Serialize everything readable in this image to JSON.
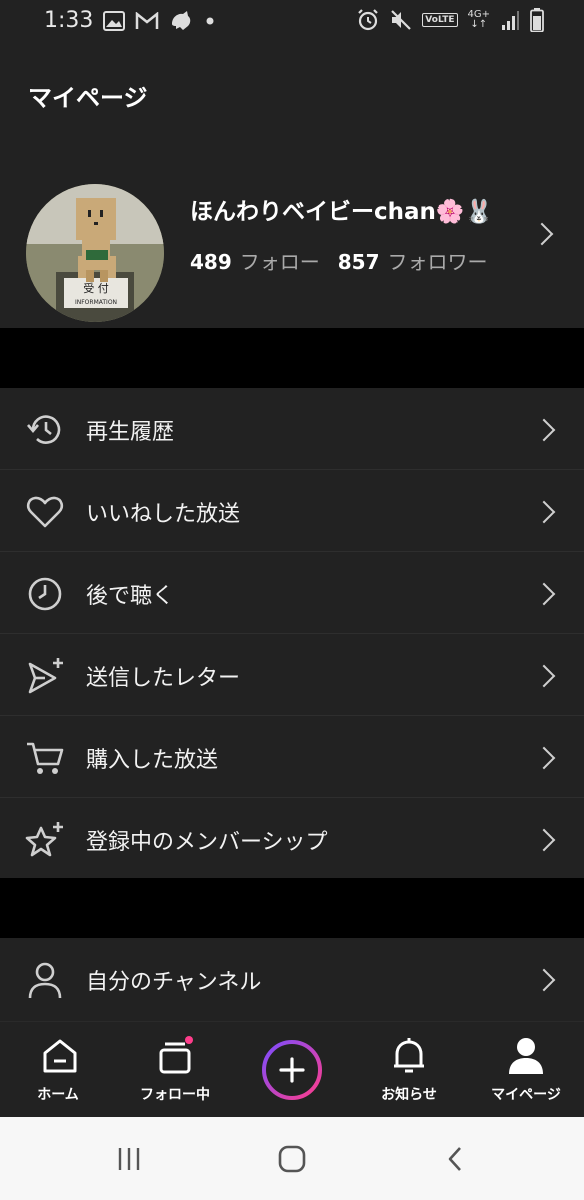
{
  "status_bar": {
    "time": "1:33",
    "left_icons": [
      "image-icon",
      "gmail-icon",
      "bird-icon",
      "dot-icon"
    ],
    "right_icons": [
      "alarm-icon",
      "mute-icon",
      "volte-icon",
      "4g-icon",
      "signal-icon",
      "battery-icon"
    ],
    "volte_label": "VoLTE",
    "network_label": "4G+"
  },
  "header": {
    "title": "マイページ",
    "profile": {
      "name": "ほんわりベイビーchan🌸🐰",
      "following_count": "489",
      "following_label": "フォロー",
      "followers_count": "857",
      "followers_label": "フォロワー",
      "avatar_sign_text": "受 付",
      "avatar_sign_subtext": "INFORMATION"
    }
  },
  "menu": {
    "items": [
      {
        "label": "再生履歴",
        "icon": "history-icon"
      },
      {
        "label": "いいねした放送",
        "icon": "heart-icon"
      },
      {
        "label": "後で聴く",
        "icon": "clock-icon"
      },
      {
        "label": "送信したレター",
        "icon": "send-plus-icon"
      },
      {
        "label": "購入した放送",
        "icon": "cart-icon"
      },
      {
        "label": "登録中のメンバーシップ",
        "icon": "star-plus-icon"
      }
    ],
    "channel_item": {
      "label": "自分のチャンネル",
      "icon": "person-icon"
    }
  },
  "tabs": [
    {
      "label": "ホーム",
      "icon": "home-icon"
    },
    {
      "label": "フォロー中",
      "icon": "following-stack-icon"
    },
    {
      "label": "",
      "icon": "plus-circle-icon"
    },
    {
      "label": "お知らせ",
      "icon": "bell-icon"
    },
    {
      "label": "マイページ",
      "icon": "person-filled-icon"
    }
  ],
  "colors": {
    "background": "#000000",
    "surface": "#222222",
    "text_primary": "#ffffff",
    "text_secondary": "#aaaaaa",
    "accent_gradient_start": "#7b4dff",
    "accent_gradient_end": "#ff3d8b",
    "notification_dot": "#ff3d8b"
  },
  "system_nav": {
    "buttons": [
      "recent-apps-icon",
      "home-circle-icon",
      "back-icon"
    ]
  }
}
